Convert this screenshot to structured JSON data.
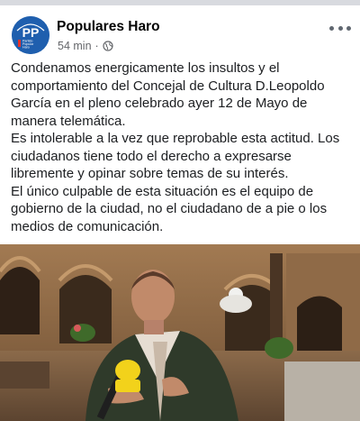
{
  "post": {
    "page_name": "Populares Haro",
    "timestamp": "54 min",
    "separator": "·",
    "privacy_icon": "globe-icon",
    "more_icon": "more-options-icon",
    "avatar": {
      "logo_text": "PP",
      "tagline_lines": [
        "Partido",
        "Popular",
        "Haro"
      ],
      "brand_color": "#1f5fae",
      "accent_color": "#e6322b"
    },
    "paragraphs": [
      "Condenamos energicamente los insultos y el comportamiento del Concejal de Cultura D.Leopoldo García en el pleno celebrado ayer 12 de Mayo de manera telemática.",
      "Es intolerable a la vez que reprobable esta actitud. Los ciudadanos tiene todo el derecho a expresarse libremente y opinar sobre temas de su interés.",
      "El único culpable de esta situación es el equipo de gobierno de la ciudad, no el ciudadano de a pie o los medios de comunicación."
    ],
    "image": {
      "subject": "man-speaking-into-microphone-in-stone-courtyard"
    }
  }
}
